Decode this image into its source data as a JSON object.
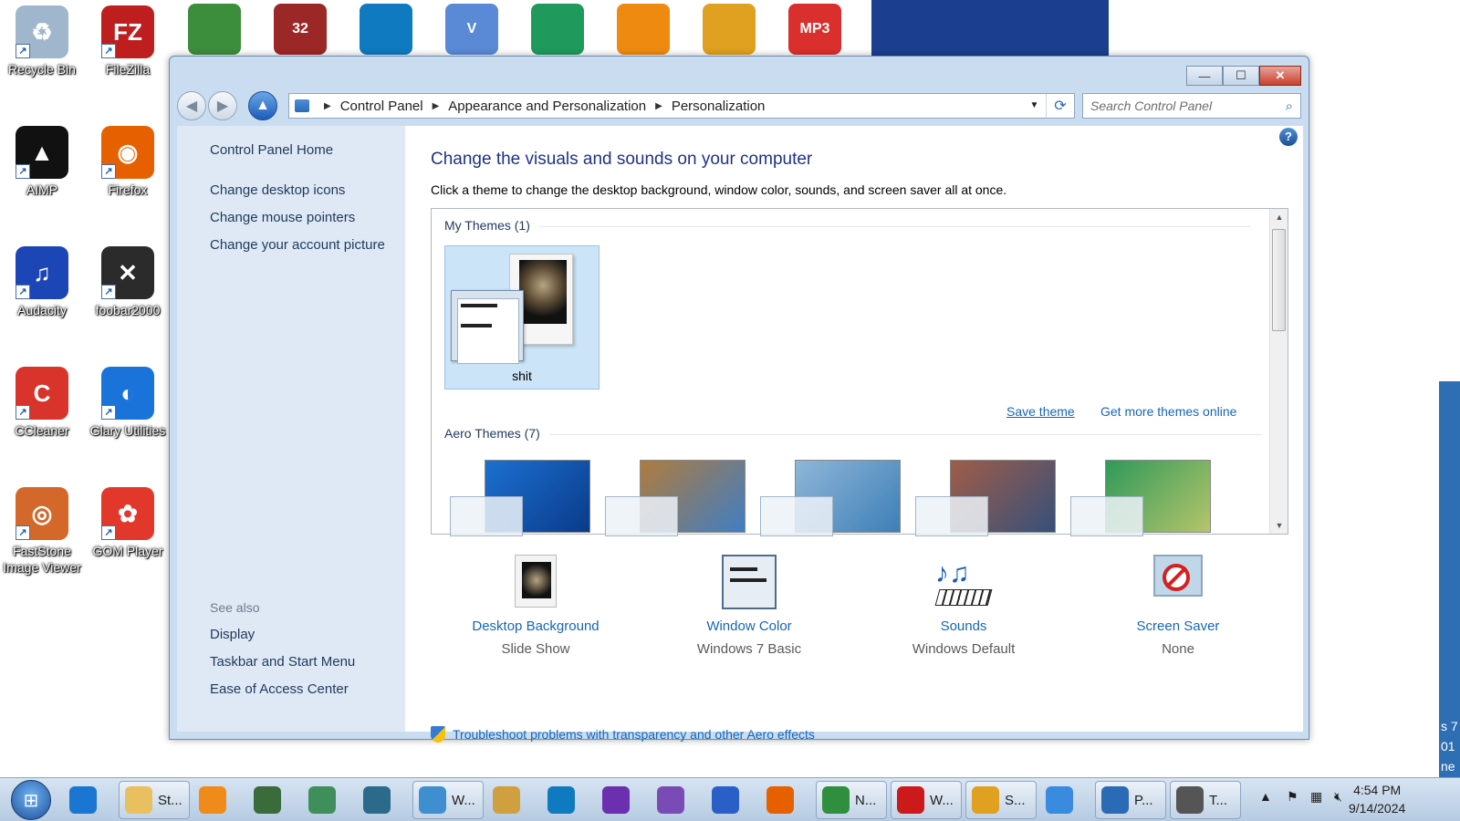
{
  "desktop": {
    "icons": [
      {
        "name": "recycle-bin",
        "label": "Recycle Bin",
        "color": "#9fb6cc",
        "glyph": "♻"
      },
      {
        "name": "filezilla",
        "label": "FileZilla",
        "color": "#bf1e1e",
        "glyph": "FZ"
      },
      {
        "name": "aimp",
        "label": "AIMP",
        "color": "#111111",
        "glyph": "▲"
      },
      {
        "name": "firefox",
        "label": "Firefox",
        "color": "#e66000",
        "glyph": "◉"
      },
      {
        "name": "audacity",
        "label": "Audacity",
        "color": "#1c46b6",
        "glyph": "♫"
      },
      {
        "name": "foobar2000",
        "label": "foobar2000",
        "color": "#2b2b2b",
        "glyph": "✕"
      },
      {
        "name": "ccleaner",
        "label": "CCleaner",
        "color": "#d8342c",
        "glyph": "C"
      },
      {
        "name": "glary-utilities",
        "label": "Glary Utilities",
        "color": "#1a73d9",
        "glyph": "◐"
      },
      {
        "name": "faststone",
        "label": "FastStone Image Viewer",
        "color": "#d4682a",
        "glyph": "◎"
      },
      {
        "name": "gom-player",
        "label": "GOM Player",
        "color": "#e2382c",
        "glyph": "✿"
      }
    ],
    "top_icons": [
      {
        "name": "chrome",
        "color": "#3c8d3c",
        "text": ""
      },
      {
        "name": "game-32",
        "color": "#9c2727",
        "text": "32"
      },
      {
        "name": "edge",
        "color": "#0f7ac0",
        "text": ""
      },
      {
        "name": "vnc",
        "color": "#5a8ad6",
        "text": "V"
      },
      {
        "name": "hummingbird",
        "color": "#1f9a5c",
        "text": ""
      },
      {
        "name": "vlc",
        "color": "#ee8a10",
        "text": ""
      },
      {
        "name": "picasa",
        "color": "#e0a020",
        "text": ""
      },
      {
        "name": "mp3",
        "color": "#d9302e",
        "text": "MP3"
      }
    ],
    "right_strip_text": [
      "s 7",
      "01",
      "ne"
    ]
  },
  "window": {
    "minimize": "—",
    "maximize": "☐",
    "close": "✕",
    "breadcrumb": [
      "Control Panel",
      "Appearance and Personalization",
      "Personalization"
    ],
    "search_placeholder": "Search Control Panel"
  },
  "sidebar": {
    "home": "Control Panel Home",
    "links": [
      "Change desktop icons",
      "Change mouse pointers",
      "Change your account picture"
    ],
    "see_also_title": "See also",
    "see_also": [
      "Display",
      "Taskbar and Start Menu",
      "Ease of Access Center"
    ]
  },
  "main": {
    "title": "Change the visuals and sounds on your computer",
    "subtitle": "Click a theme to change the desktop background, window color, sounds, and screen saver all at once.",
    "my_themes_header": "My Themes (1)",
    "my_theme_name": "shit",
    "save_theme": "Save theme",
    "get_more": "Get more themes online",
    "aero_header": "Aero Themes (7)",
    "aero_colors": [
      {
        "a": "#1c70d0",
        "b": "#0a3b8a"
      },
      {
        "a": "#b07b3c",
        "b": "#3f7ec4"
      },
      {
        "a": "#8fb6d8",
        "b": "#3d7fb7"
      },
      {
        "a": "#a05c48",
        "b": "#36507a"
      },
      {
        "a": "#2e9a5a",
        "b": "#b6c46a"
      }
    ],
    "options": [
      {
        "name": "desktop-background",
        "label": "Desktop Background",
        "value": "Slide Show"
      },
      {
        "name": "window-color",
        "label": "Window Color",
        "value": "Windows 7 Basic"
      },
      {
        "name": "sounds",
        "label": "Sounds",
        "value": "Windows Default"
      },
      {
        "name": "screen-saver",
        "label": "Screen Saver",
        "value": "None"
      }
    ],
    "troubleshoot": "Troubleshoot problems with transparency and other Aero effects"
  },
  "taskbar": {
    "start_glyph": "⊞",
    "items": [
      {
        "name": "ie",
        "label": "",
        "color": "#1b76d2",
        "grouped": false
      },
      {
        "name": "explorer-st",
        "label": "St...",
        "color": "#e8c060",
        "grouped": true
      },
      {
        "name": "media-player",
        "label": "",
        "color": "#f08a1a",
        "grouped": false
      },
      {
        "name": "computer",
        "label": "",
        "color": "#3a6b3a",
        "grouped": false
      },
      {
        "name": "globe",
        "label": "",
        "color": "#3f8f5c",
        "grouped": false
      },
      {
        "name": "notes",
        "label": "",
        "color": "#2b6a8a",
        "grouped": false
      },
      {
        "name": "contacts-w",
        "label": "W...",
        "color": "#3f8fd0",
        "grouped": true
      },
      {
        "name": "paint",
        "label": "",
        "color": "#d0a040",
        "grouped": false
      },
      {
        "name": "edge",
        "label": "",
        "color": "#0f7ac0",
        "grouped": false
      },
      {
        "name": "yahoo",
        "label": "",
        "color": "#6b2fb0",
        "grouped": false
      },
      {
        "name": "visual-studio",
        "label": "",
        "color": "#7b4bb5",
        "grouped": false
      },
      {
        "name": "crystal",
        "label": "",
        "color": "#2a5fc8",
        "grouped": false
      },
      {
        "name": "firefox",
        "label": "",
        "color": "#e66000",
        "grouped": false
      },
      {
        "name": "chrome-n",
        "label": "N...",
        "color": "#2f8f3f",
        "grouped": true
      },
      {
        "name": "opera-w",
        "label": "W...",
        "color": "#cc1a1a",
        "grouped": true
      },
      {
        "name": "app-s",
        "label": "S...",
        "color": "#e0a020",
        "grouped": true
      },
      {
        "name": "windows-flag",
        "label": "",
        "color": "#3a8ae0",
        "grouped": false
      },
      {
        "name": "control-panel-p",
        "label": "P...",
        "color": "#2b6ab5",
        "grouped": true
      },
      {
        "name": "app-t",
        "label": "T...",
        "color": "#555555",
        "grouped": true
      }
    ],
    "time": "4:54 PM",
    "date": "9/14/2024"
  }
}
